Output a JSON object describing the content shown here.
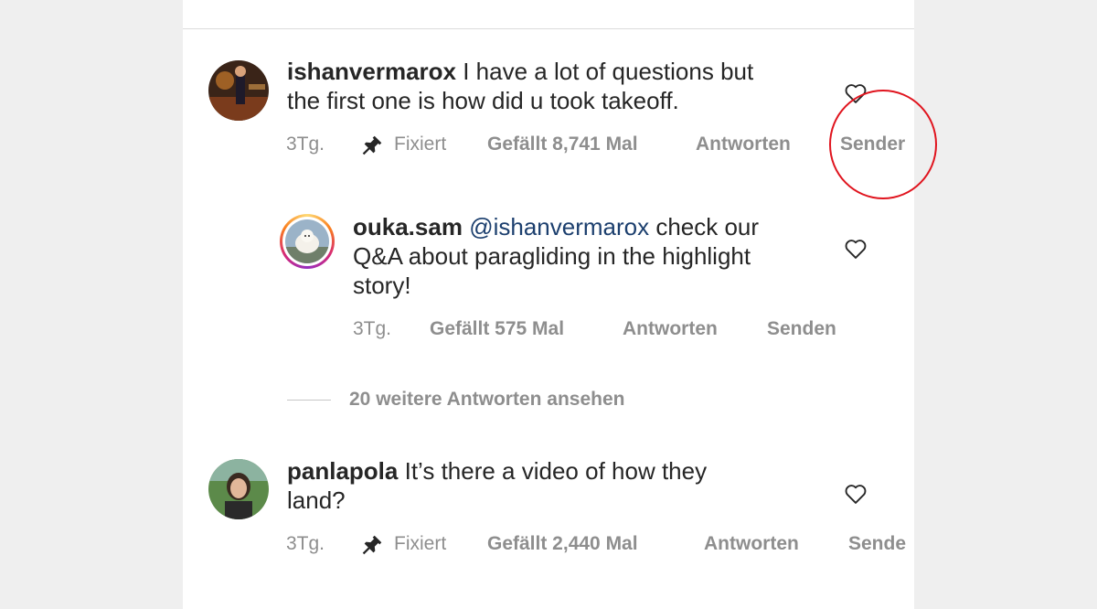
{
  "comments": [
    {
      "username": "ishanvermarox",
      "text_line1": "I have a lot of questions but",
      "text_line2": "the first one is how did u took takeoff.",
      "time": "3Tg.",
      "pinned_label": "Fixiert",
      "likes": "Gefällt 8,741 Mal",
      "reply_label": "Antworten",
      "send_label": "Sender"
    },
    {
      "username": "ouka.sam",
      "mention": "@ishanvermarox",
      "text_line1_rest": " check our",
      "text_line2": "Q&A about paragliding in the highlight",
      "text_line3": "story!",
      "time": "3Tg.",
      "likes": "Gefällt 575 Mal",
      "reply_label": "Antworten",
      "send_label": "Senden"
    },
    {
      "username": "panlapola",
      "text_line1": "It’s there a video of how they",
      "text_line2": "land?",
      "time": "3Tg.",
      "pinned_label": "Fixiert",
      "likes": "Gefällt 2,440 Mal",
      "reply_label": "Antworten",
      "send_label": "Sende"
    }
  ],
  "view_more_replies": "20 weitere Antworten ansehen",
  "colors": {
    "text": "#262626",
    "meta": "#8e8e8e",
    "mention": "#1c3f6e",
    "highlight_circle": "#e0141e"
  },
  "icons": [
    "heart-icon",
    "pin-icon"
  ]
}
